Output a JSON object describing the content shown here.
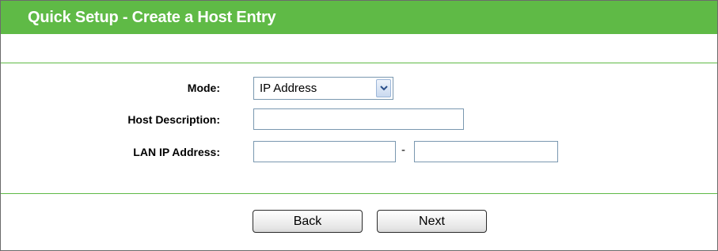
{
  "header": {
    "title": "Quick Setup - Create a Host Entry"
  },
  "form": {
    "mode": {
      "label": "Mode:",
      "selected": "IP Address"
    },
    "host_description": {
      "label": "Host Description:",
      "value": ""
    },
    "lan_ip": {
      "label": "LAN IP Address:",
      "start_value": "",
      "end_value": "",
      "separator": "-"
    }
  },
  "buttons": {
    "back": "Back",
    "next": "Next"
  },
  "colors": {
    "accent": "#5fba46"
  }
}
